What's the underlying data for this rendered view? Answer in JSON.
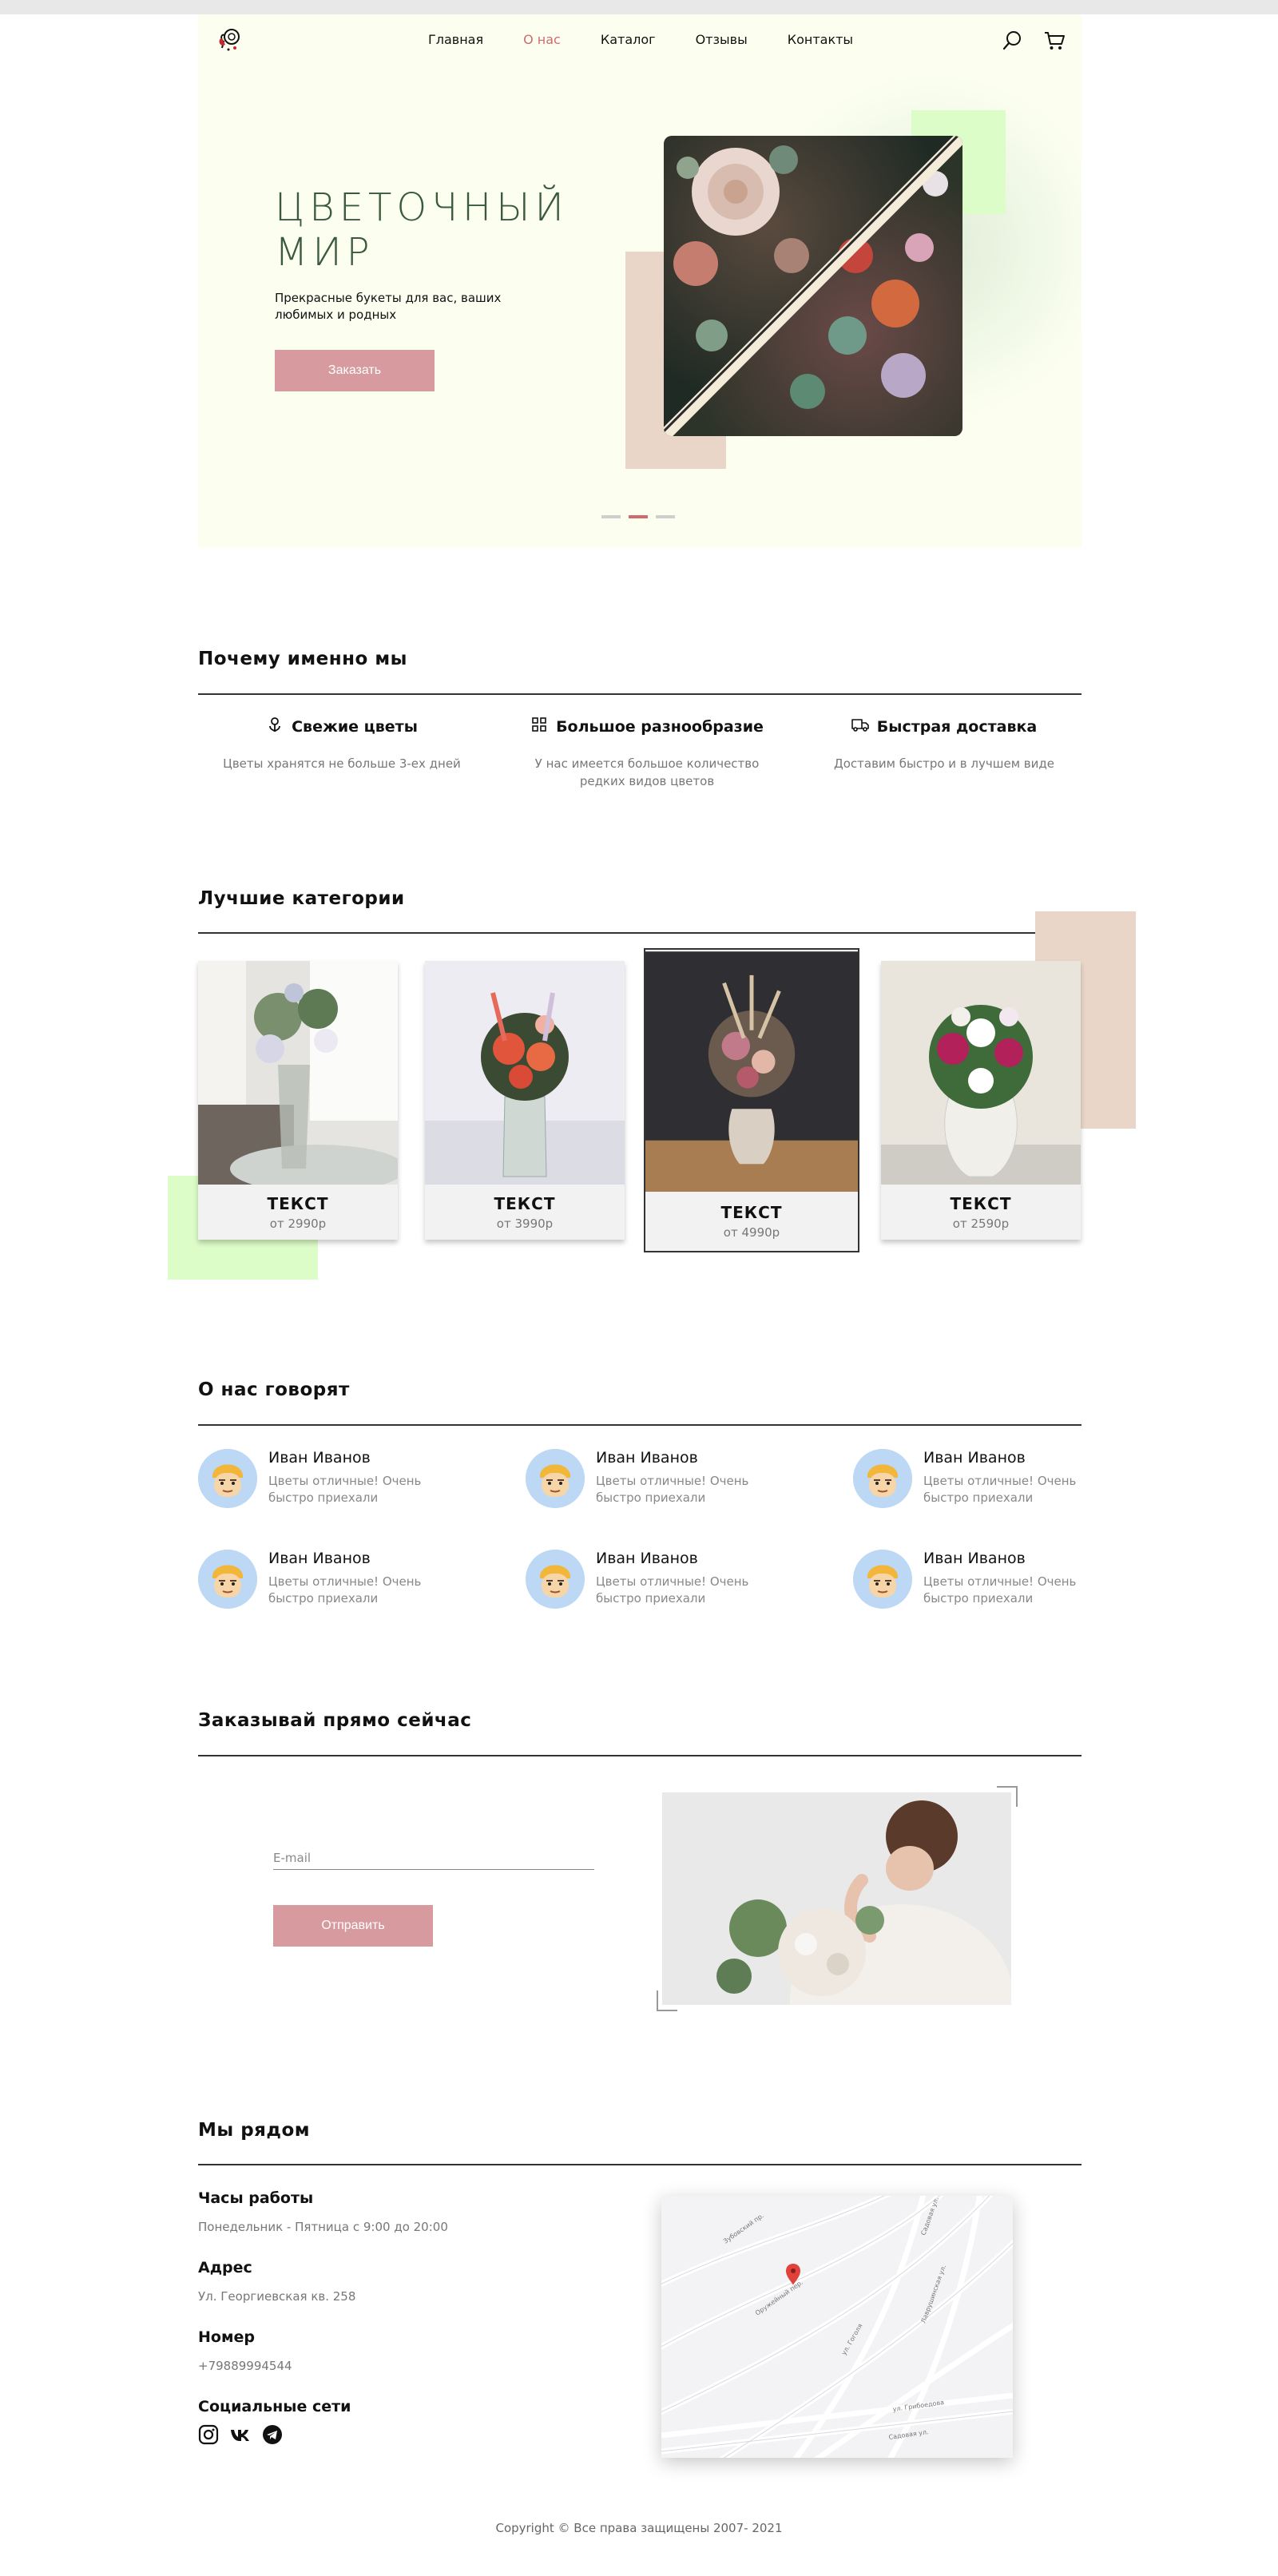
{
  "header": {
    "nav": [
      "Главная",
      "О нас",
      "Каталог",
      "Отзывы",
      "Контакты"
    ],
    "active_nav": "О нас"
  },
  "hero": {
    "title_line1": "ЦВЕТОЧНЫЙ",
    "title_line2": "МИР",
    "subtitle": "Прекрасные букеты для вас, ваших любимых и родных",
    "cta": "Заказать",
    "slides": 3,
    "active_slide": 2
  },
  "why": {
    "title": "Почему именно мы",
    "features": [
      {
        "title": "Свежие цветы",
        "desc": "Цветы хранятся не больше 3-ех дней",
        "icon": "flower-icon"
      },
      {
        "title": "Большое разнообразие",
        "desc": "У нас имеется большое количество редких видов цветов",
        "icon": "grid-icon"
      },
      {
        "title": "Быстрая доставка",
        "desc": "Доставим быстро и в лучшем виде",
        "icon": "truck-icon"
      }
    ]
  },
  "categories": {
    "title": "Лучшие категории",
    "items": [
      {
        "name": "ТЕКСТ",
        "price": "от 2990р"
      },
      {
        "name": "ТЕКСТ",
        "price": "от 3990р"
      },
      {
        "name": "ТЕКСТ",
        "price": "от 4990р"
      },
      {
        "name": "ТЕКСТ",
        "price": "от 2590р"
      }
    ]
  },
  "reviews": {
    "title": "О нас говорят",
    "items": [
      {
        "name": "Иван Иванов",
        "text": "Цветы отличные! Очень быстро приехали"
      },
      {
        "name": "Иван Иванов",
        "text": "Цветы отличные! Очень быстро приехали"
      },
      {
        "name": "Иван Иванов",
        "text": "Цветы отличные! Очень быстро приехали"
      },
      {
        "name": "Иван Иванов",
        "text": "Цветы отличные! Очень быстро приехали"
      },
      {
        "name": "Иван Иванов",
        "text": "Цветы отличные! Очень быстро приехали"
      },
      {
        "name": "Иван Иванов",
        "text": "Цветы отличные! Очень быстро приехали"
      }
    ]
  },
  "order": {
    "title": "Заказывай прямо сейчас",
    "email_placeholder": "E-mail",
    "submit": "Отправить"
  },
  "contacts": {
    "title": "Мы рядом",
    "hours_label": "Часы работы",
    "hours": "Понедельник - Пятница с 9:00 до 20:00",
    "address_label": "Адрес",
    "address": "Ул. Георгиевская кв. 258",
    "phone_label": "Номер",
    "phone": "+79889994544",
    "social_label": "Социальные сети",
    "social": [
      "instagram-icon",
      "vk-icon",
      "telegram-icon"
    ],
    "map_streets": [
      "Зубовский пр.",
      "Садовая ул.",
      "Оружейный пер.",
      "Лаврушинская ул.",
      "ул. Грибоедова",
      "ул. Гоголя",
      "Садовая ул."
    ]
  },
  "footer": {
    "copyright": "Copyright © Все права защищены 2007- 2021"
  },
  "colors": {
    "accent": "#d79b9f",
    "active_nav": "#d06a6f",
    "hero_bg": "#fcfff0",
    "hero_title": "#3a5a3b",
    "beige": "#e9d6c8",
    "mint": "#dcfcc8"
  }
}
